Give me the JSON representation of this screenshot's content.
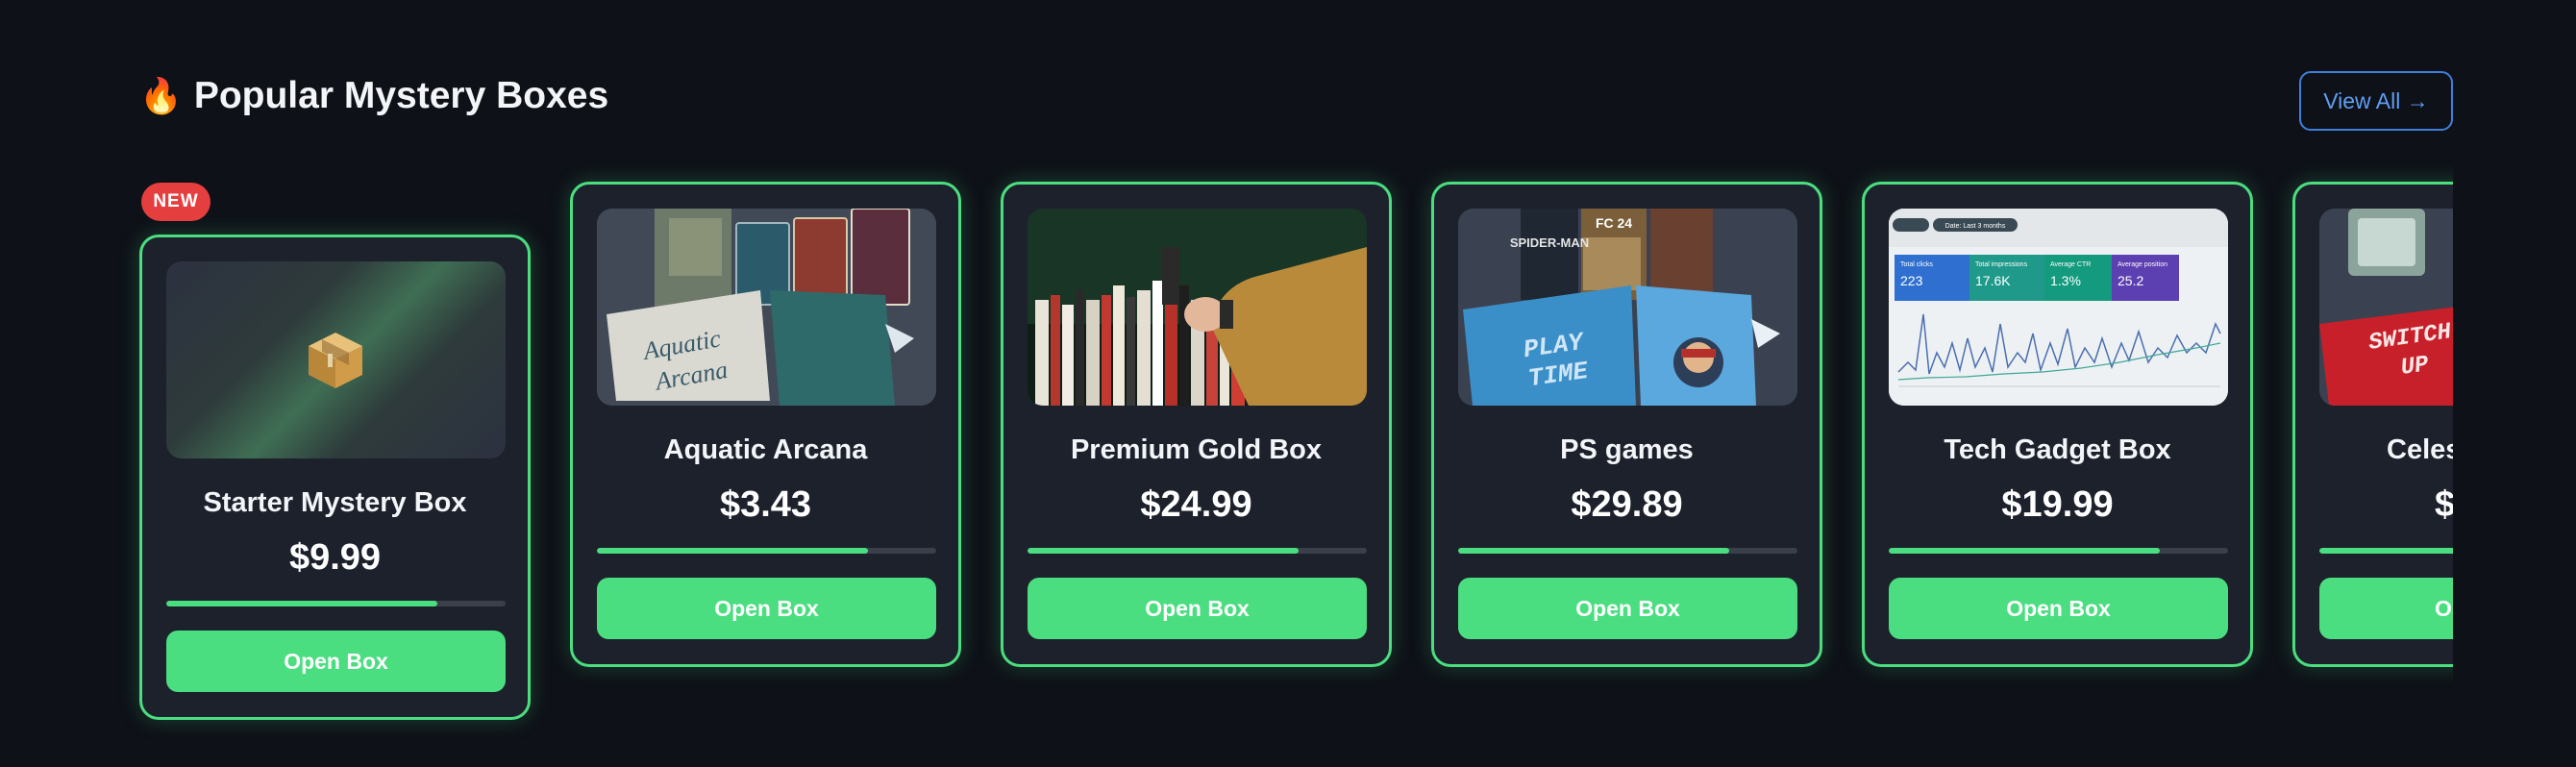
{
  "section": {
    "title": "Popular Mystery Boxes",
    "title_icon": "fire-icon",
    "view_all_label": "View All →"
  },
  "badge": {
    "label": "NEW"
  },
  "cards": [
    {
      "name": "Starter Mystery Box",
      "price": "$9.99",
      "button": "Open Box",
      "progress": 0.8,
      "image": "package-box-icon"
    },
    {
      "name": "Aquatic Arcana",
      "price": "$3.43",
      "button": "Open Box",
      "progress": 0.8,
      "image": "trading-cards-image"
    },
    {
      "name": "Premium Gold Box",
      "price": "$24.99",
      "button": "Open Box",
      "progress": 0.8,
      "image": "bookshelf-image"
    },
    {
      "name": "PS games",
      "price": "$29.89",
      "button": "Open Box",
      "progress": 0.8,
      "image": "game-covers-image"
    },
    {
      "name": "Tech Gadget Box",
      "price": "$19.99",
      "button": "Open Box",
      "progress": 0.8,
      "image": "analytics-dashboard-image"
    },
    {
      "name": "Celest",
      "price": "$",
      "button": "O",
      "progress": 0.8,
      "image": "switch-up-box-image"
    }
  ],
  "images": {
    "aquatic_box_text": "Aquatic Arcana",
    "ps_box_text": "PLAY TIME",
    "switch_box_text": "SWITCH UP",
    "ps_cover_1": "SPIDER-MAN",
    "ps_cover_2": "FC 24",
    "dashboard_filter": "Date: Last 3 months",
    "dashboard_metrics": [
      {
        "label": "Total clicks",
        "value": "223"
      },
      {
        "label": "Total impressions",
        "value": "17.6K"
      },
      {
        "label": "Average CTR",
        "value": "1.3%"
      },
      {
        "label": "Average position",
        "value": "25.2"
      }
    ]
  },
  "colors": {
    "accent": "#4ade80",
    "badge": "#e53e3e",
    "link": "#5f9ef2",
    "card_bg": "#1c212c",
    "page_bg": "#0e1118"
  }
}
